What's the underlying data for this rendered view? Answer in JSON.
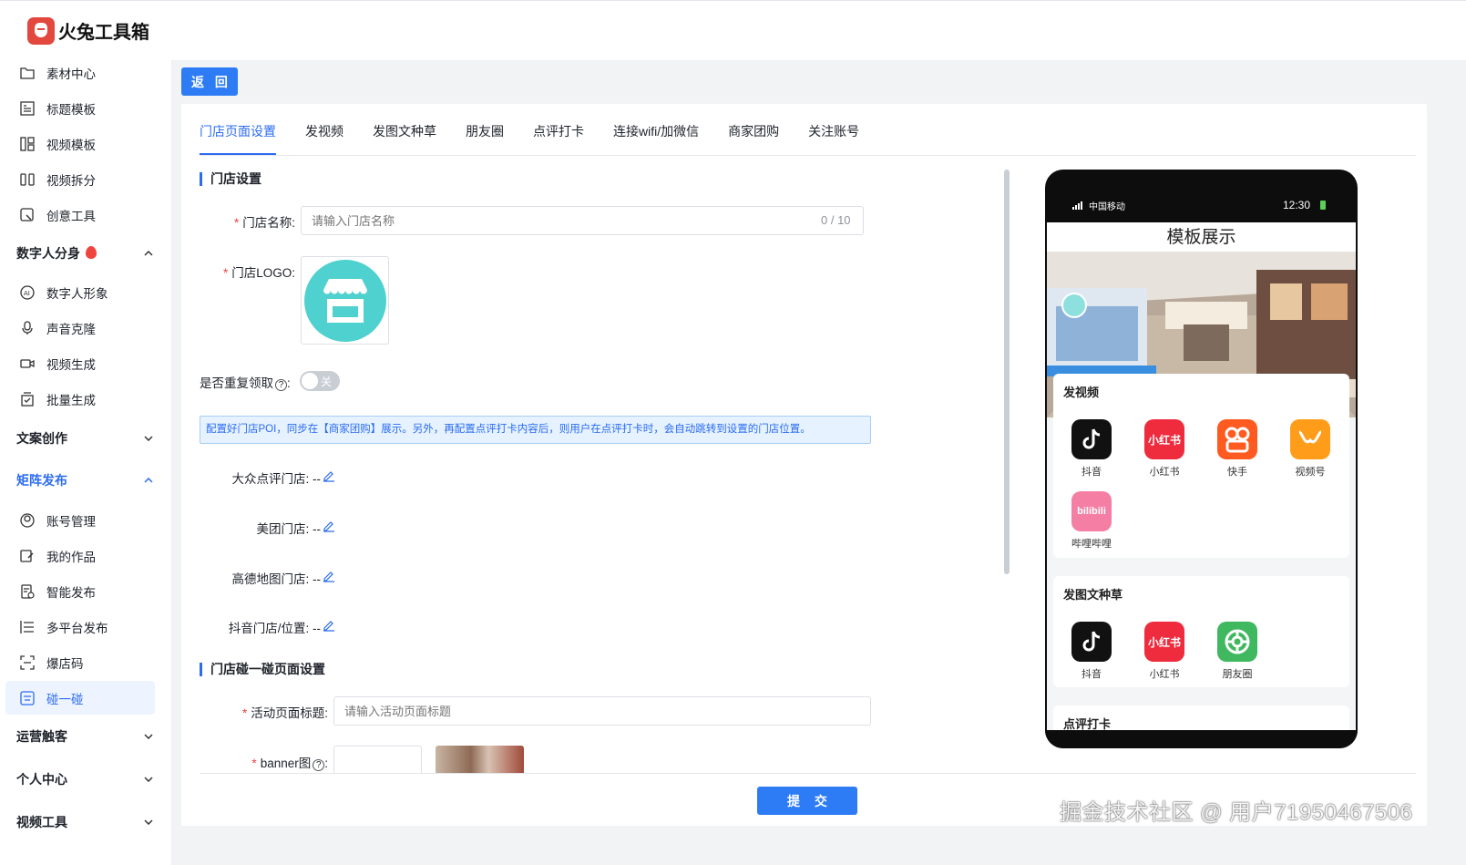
{
  "app": {
    "title": "火兔工具箱",
    "logo": "rabbit-logo"
  },
  "sidebar": {
    "items_top": [
      {
        "label": "素材中心",
        "icon": "folder-icon"
      },
      {
        "label": "标题模板",
        "icon": "title-template-icon"
      },
      {
        "label": "视频模板",
        "icon": "video-template-icon"
      },
      {
        "label": "视频拆分",
        "icon": "video-split-icon"
      },
      {
        "label": "创意工具",
        "icon": "creative-tool-icon"
      }
    ],
    "group_digital": {
      "label": "数字人分身",
      "expanded": true
    },
    "items_digital": [
      {
        "label": "数字人形象",
        "icon": "ai-avatar-icon"
      },
      {
        "label": "声音克隆",
        "icon": "microphone-icon"
      },
      {
        "label": "视频生成",
        "icon": "video-camera-icon"
      },
      {
        "label": "批量生成",
        "icon": "batch-icon"
      }
    ],
    "group_copy": {
      "label": "文案创作",
      "expanded": false
    },
    "group_matrix": {
      "label": "矩阵发布",
      "expanded": true
    },
    "items_matrix": [
      {
        "label": "账号管理",
        "icon": "account-icon"
      },
      {
        "label": "我的作品",
        "icon": "works-icon"
      },
      {
        "label": "智能发布",
        "icon": "smart-publish-icon"
      },
      {
        "label": "多平台发布",
        "icon": "multi-platform-icon"
      },
      {
        "label": "爆店码",
        "icon": "qr-scan-icon"
      },
      {
        "label": "碰一碰",
        "icon": "tap-icon",
        "active": true
      }
    ],
    "group_ops": {
      "label": "运营触客",
      "expanded": false
    },
    "group_personal": {
      "label": "个人中心",
      "expanded": false
    },
    "group_video_tools": {
      "label": "视频工具",
      "expanded": false
    }
  },
  "main": {
    "back_label": "返 回",
    "tabs": [
      {
        "label": "门店页面设置",
        "active": true
      },
      {
        "label": "发视频"
      },
      {
        "label": "发图文种草"
      },
      {
        "label": "朋友圈"
      },
      {
        "label": "点评打卡"
      },
      {
        "label": "连接wifi/加微信"
      },
      {
        "label": "商家团购"
      },
      {
        "label": "关注账号"
      }
    ],
    "section_store": "门店设置",
    "store_name_label": "门店名称:",
    "store_name_placeholder": "请输入门店名称",
    "store_name_counter": "0 / 10",
    "store_logo_label": "门店LOGO:",
    "repeat_label": "是否重复领取",
    "repeat_colon": ":",
    "repeat_toggle": "关",
    "notice": "配置好门店POI，同步在【商家团购】展示。另外，再配置点评打卡内容后，则用户在点评打卡时，会自动跳转到设置的门店位置。",
    "dianping_label": "大众点评门店:",
    "dianping_value": "--",
    "meituan_label": "美团门店:",
    "meituan_value": "--",
    "gaode_label": "高德地图门店:",
    "gaode_value": "--",
    "douyin_label": "抖音门店/位置:",
    "douyin_value": "--",
    "section_tap": "门店碰一碰页面设置",
    "activity_title_label": "活动页面标题:",
    "activity_title_placeholder": "请输入活动页面标题",
    "banner_label": "banner图",
    "banner_colon": ":",
    "submit_label": "提 交"
  },
  "preview": {
    "carrier": "中国移动",
    "time": "12:30",
    "title": "模板展示",
    "section_video": "发视频",
    "video_apps": [
      {
        "label": "抖音",
        "icon": "douyin-icon"
      },
      {
        "label": "小红书",
        "icon": "xiaohongshu-icon",
        "text": "小红书"
      },
      {
        "label": "快手",
        "icon": "kuaishou-icon"
      },
      {
        "label": "视频号",
        "icon": "wechat-channels-icon"
      },
      {
        "label": "哔哩哔哩",
        "icon": "bilibili-icon",
        "text": "bilibili"
      }
    ],
    "section_image": "发图文种草",
    "image_apps": [
      {
        "label": "抖音",
        "icon": "douyin-icon"
      },
      {
        "label": "小红书",
        "icon": "xiaohongshu-icon",
        "text": "小红书"
      },
      {
        "label": "朋友圈",
        "icon": "moments-icon"
      }
    ],
    "section_checkin": "点评打卡"
  },
  "watermark": "掘金技术社区 @ 用户71950467506",
  "colors": {
    "accent": "#2b6cf0",
    "button": "#2d7cf5",
    "required": "#f53f3f"
  }
}
